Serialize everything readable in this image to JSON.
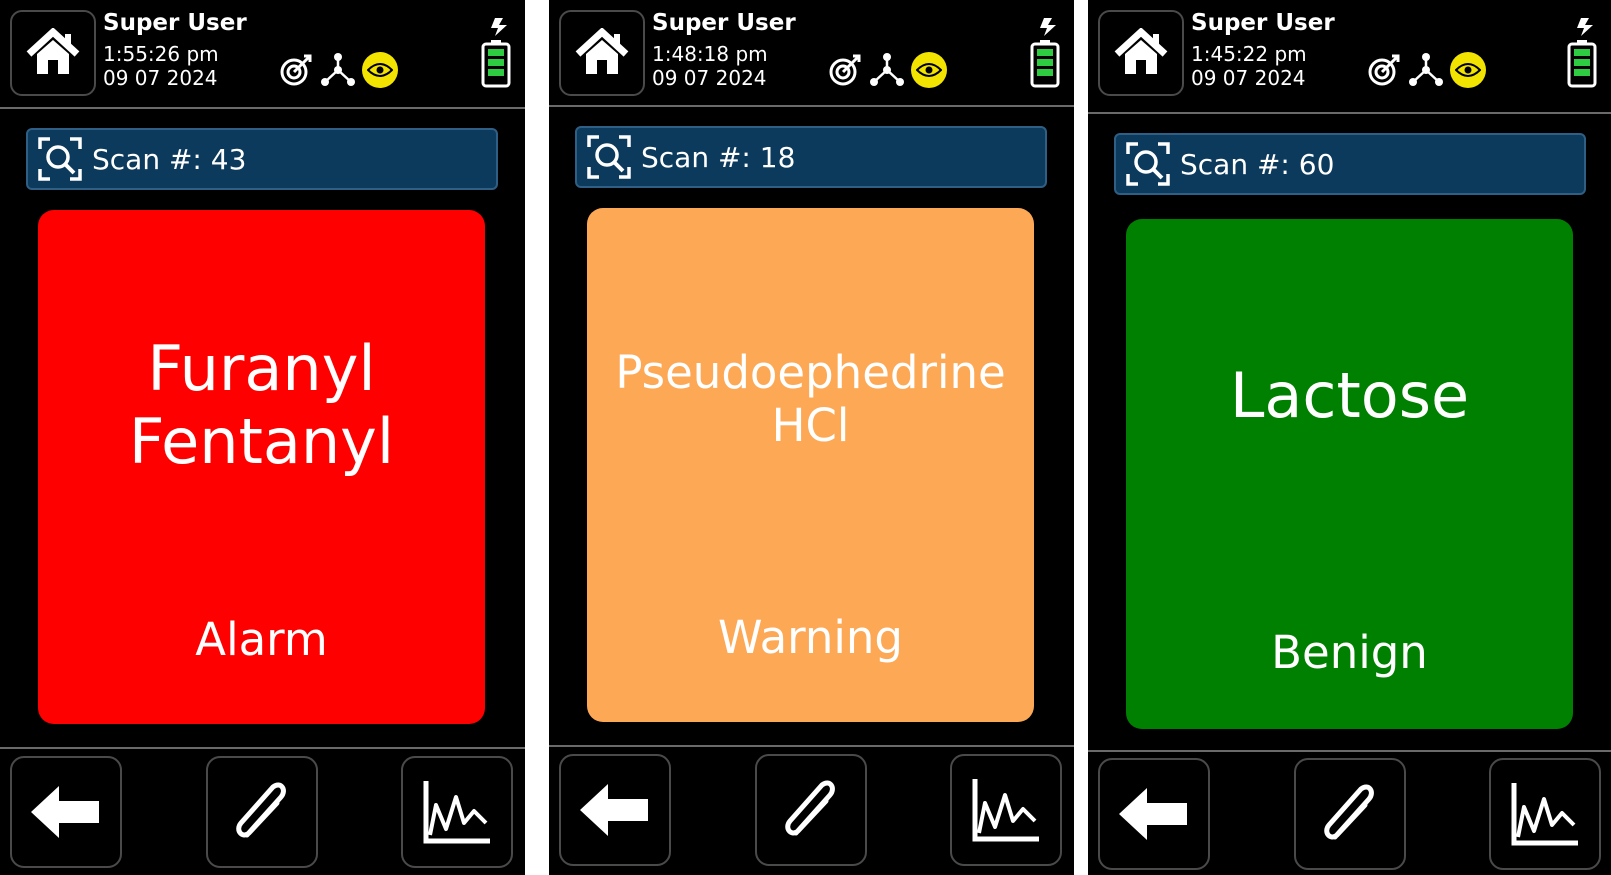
{
  "panels": [
    {
      "user": "Super User",
      "time": "1:55:26 pm",
      "date": "09 07 2024",
      "scan_label": "Scan #: 43",
      "substance": "Furanyl\nFentanyl",
      "status": "Alarm",
      "card_color": "#ff0000"
    },
    {
      "user": "Super User",
      "time": "1:48:18 pm",
      "date": "09 07 2024",
      "scan_label": "Scan #: 18",
      "substance": "Pseudoephedrine\nHCl",
      "status": "Warning",
      "card_color": "#fda855"
    },
    {
      "user": "Super User",
      "time": "1:45:22 pm",
      "date": "09 07 2024",
      "scan_label": "Scan #: 60",
      "substance": "Lactose",
      "status": "Benign",
      "card_color": "#008000"
    }
  ],
  "icons": {
    "home": "home-icon",
    "target": "target-icon",
    "network": "network-icon",
    "eye": "eye-icon",
    "battery": "battery-charging-icon",
    "scan": "scan-search-icon",
    "back": "back-arrow-icon",
    "attach": "paperclip-icon",
    "chart": "spectrum-chart-icon"
  },
  "colors": {
    "scan_bar": "#0b3a5c",
    "eye_badge": "#f2e400",
    "battery": "#2ecc40"
  }
}
